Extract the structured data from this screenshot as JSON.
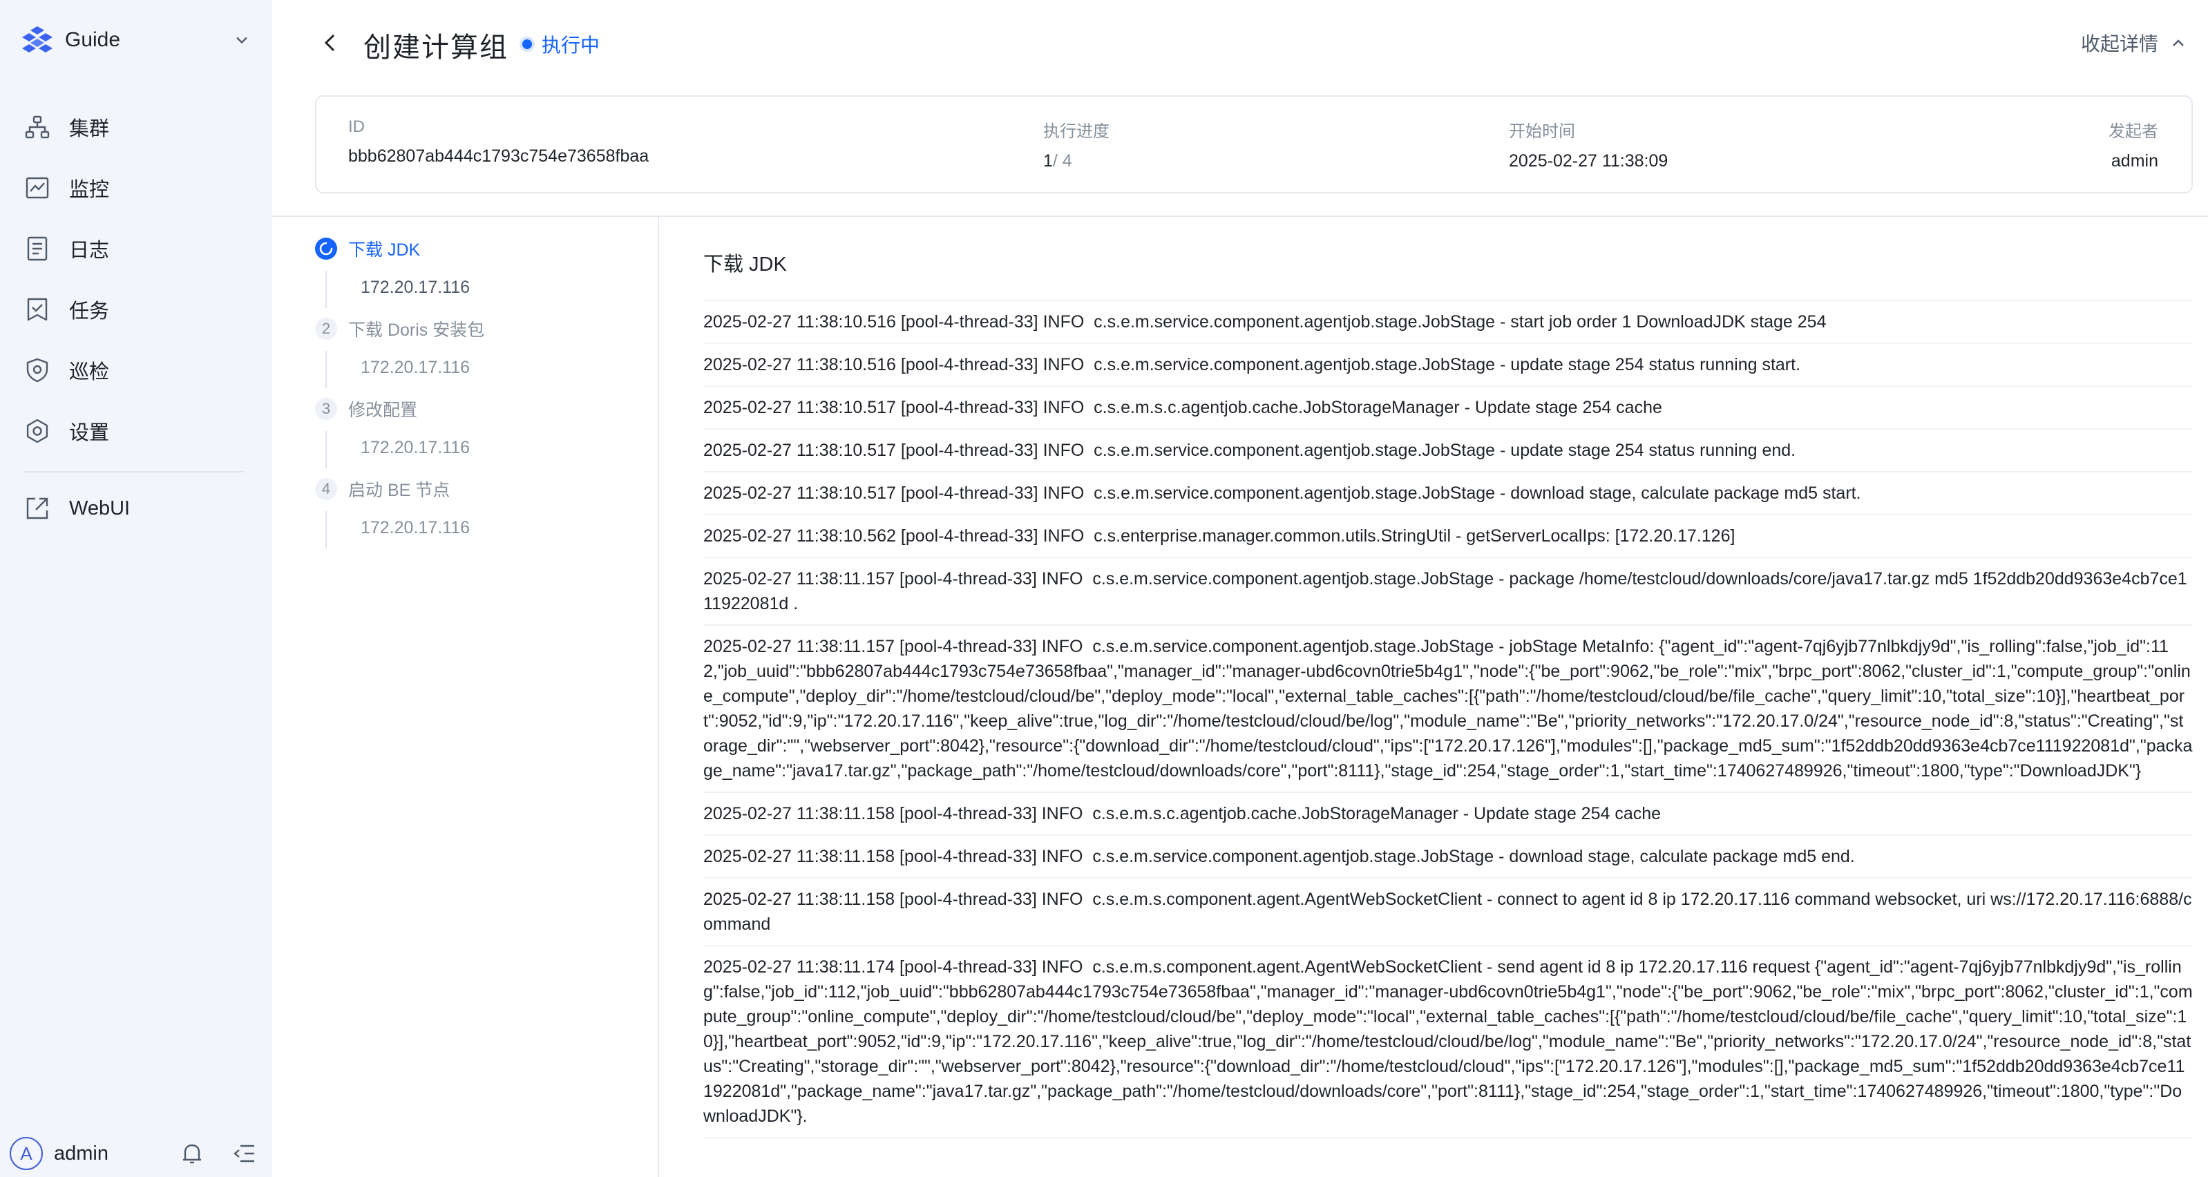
{
  "sidebar": {
    "brand": "Guide",
    "items": [
      {
        "label": "集群",
        "icon": "cluster-icon"
      },
      {
        "label": "监控",
        "icon": "monitor-icon"
      },
      {
        "label": "日志",
        "icon": "log-icon"
      },
      {
        "label": "任务",
        "icon": "task-icon"
      },
      {
        "label": "巡检",
        "icon": "inspection-icon"
      },
      {
        "label": "设置",
        "icon": "gear-icon"
      }
    ],
    "webui": {
      "label": "WebUI",
      "icon": "external-link-icon"
    },
    "user": {
      "avatar": "A",
      "name": "admin"
    }
  },
  "header": {
    "title": "创建计算组",
    "status": "执行中",
    "collapse_label": "收起详情"
  },
  "info": {
    "id_label": "ID",
    "id_value": "bbb62807ab444c1793c754e73658fbaa",
    "progress_label": "执行进度",
    "progress_done": "1",
    "progress_total": "/ 4",
    "start_label": "开始时间",
    "start_value": "2025-02-27 11:38:09",
    "initiator_label": "发起者",
    "initiator_value": "admin"
  },
  "steps": [
    {
      "num": "",
      "name": "下载 JDK",
      "host": "172.20.17.116",
      "active": true
    },
    {
      "num": "2",
      "name": "下载 Doris 安装包",
      "host": "172.20.17.116",
      "active": false
    },
    {
      "num": "3",
      "name": "修改配置",
      "host": "172.20.17.116",
      "active": false
    },
    {
      "num": "4",
      "name": "启动 BE 节点",
      "host": "172.20.17.116",
      "active": false
    }
  ],
  "log": {
    "title": "下载 JDK",
    "entries": [
      "2025-02-27 11:38:10.516 [pool-4-thread-33] INFO  c.s.e.m.service.component.agentjob.stage.JobStage - start job order 1 DownloadJDK stage 254",
      "2025-02-27 11:38:10.516 [pool-4-thread-33] INFO  c.s.e.m.service.component.agentjob.stage.JobStage - update stage 254 status running start.",
      "2025-02-27 11:38:10.517 [pool-4-thread-33] INFO  c.s.e.m.s.c.agentjob.cache.JobStorageManager - Update stage 254 cache",
      "2025-02-27 11:38:10.517 [pool-4-thread-33] INFO  c.s.e.m.service.component.agentjob.stage.JobStage - update stage 254 status running end.",
      "2025-02-27 11:38:10.517 [pool-4-thread-33] INFO  c.s.e.m.service.component.agentjob.stage.JobStage - download stage, calculate package md5 start.",
      "2025-02-27 11:38:10.562 [pool-4-thread-33] INFO  c.s.enterprise.manager.common.utils.StringUtil - getServerLocalIps: [172.20.17.126]",
      "2025-02-27 11:38:11.157 [pool-4-thread-33] INFO  c.s.e.m.service.component.agentjob.stage.JobStage - package /home/testcloud/downloads/core/java17.tar.gz md5 1f52ddb20dd9363e4cb7ce111922081d .",
      "2025-02-27 11:38:11.157 [pool-4-thread-33] INFO  c.s.e.m.service.component.agentjob.stage.JobStage - jobStage MetaInfo: {\"agent_id\":\"agent-7qj6yjb77nlbkdjy9d\",\"is_rolling\":false,\"job_id\":112,\"job_uuid\":\"bbb62807ab444c1793c754e73658fbaa\",\"manager_id\":\"manager-ubd6covn0trie5b4g1\",\"node\":{\"be_port\":9062,\"be_role\":\"mix\",\"brpc_port\":8062,\"cluster_id\":1,\"compute_group\":\"online_compute\",\"deploy_dir\":\"/home/testcloud/cloud/be\",\"deploy_mode\":\"local\",\"external_table_caches\":[{\"path\":\"/home/testcloud/cloud/be/file_cache\",\"query_limit\":10,\"total_size\":10}],\"heartbeat_port\":9052,\"id\":9,\"ip\":\"172.20.17.116\",\"keep_alive\":true,\"log_dir\":\"/home/testcloud/cloud/be/log\",\"module_name\":\"Be\",\"priority_networks\":\"172.20.17.0/24\",\"resource_node_id\":8,\"status\":\"Creating\",\"storage_dir\":\"\",\"webserver_port\":8042},\"resource\":{\"download_dir\":\"/home/testcloud/cloud\",\"ips\":[\"172.20.17.126\"],\"modules\":[],\"package_md5_sum\":\"1f52ddb20dd9363e4cb7ce111922081d\",\"package_name\":\"java17.tar.gz\",\"package_path\":\"/home/testcloud/downloads/core\",\"port\":8111},\"stage_id\":254,\"stage_order\":1,\"start_time\":1740627489926,\"timeout\":1800,\"type\":\"DownloadJDK\"}",
      "2025-02-27 11:38:11.158 [pool-4-thread-33] INFO  c.s.e.m.s.c.agentjob.cache.JobStorageManager - Update stage 254 cache",
      "2025-02-27 11:38:11.158 [pool-4-thread-33] INFO  c.s.e.m.service.component.agentjob.stage.JobStage - download stage, calculate package md5 end.",
      "2025-02-27 11:38:11.158 [pool-4-thread-33] INFO  c.s.e.m.s.component.agent.AgentWebSocketClient - connect to agent id 8 ip 172.20.17.116 command websocket, uri ws://172.20.17.116:6888/command",
      "2025-02-27 11:38:11.174 [pool-4-thread-33] INFO  c.s.e.m.s.component.agent.AgentWebSocketClient - send agent id 8 ip 172.20.17.116 request {\"agent_id\":\"agent-7qj6yjb77nlbkdjy9d\",\"is_rolling\":false,\"job_id\":112,\"job_uuid\":\"bbb62807ab444c1793c754e73658fbaa\",\"manager_id\":\"manager-ubd6covn0trie5b4g1\",\"node\":{\"be_port\":9062,\"be_role\":\"mix\",\"brpc_port\":8062,\"cluster_id\":1,\"compute_group\":\"online_compute\",\"deploy_dir\":\"/home/testcloud/cloud/be\",\"deploy_mode\":\"local\",\"external_table_caches\":[{\"path\":\"/home/testcloud/cloud/be/file_cache\",\"query_limit\":10,\"total_size\":10}],\"heartbeat_port\":9052,\"id\":9,\"ip\":\"172.20.17.116\",\"keep_alive\":true,\"log_dir\":\"/home/testcloud/cloud/be/log\",\"module_name\":\"Be\",\"priority_networks\":\"172.20.17.0/24\",\"resource_node_id\":8,\"status\":\"Creating\",\"storage_dir\":\"\",\"webserver_port\":8042},\"resource\":{\"download_dir\":\"/home/testcloud/cloud\",\"ips\":[\"172.20.17.126\"],\"modules\":[],\"package_md5_sum\":\"1f52ddb20dd9363e4cb7ce111922081d\",\"package_name\":\"java17.tar.gz\",\"package_path\":\"/home/testcloud/downloads/core\",\"port\":8111},\"stage_id\":254,\"stage_order\":1,\"start_time\":1740627489926,\"timeout\":1800,\"type\":\"DownloadJDK\"}."
    ]
  },
  "colors": {
    "accent": "#1664ff",
    "sidebar_bg": "#f2f5fc",
    "muted_text": "#86909c"
  }
}
